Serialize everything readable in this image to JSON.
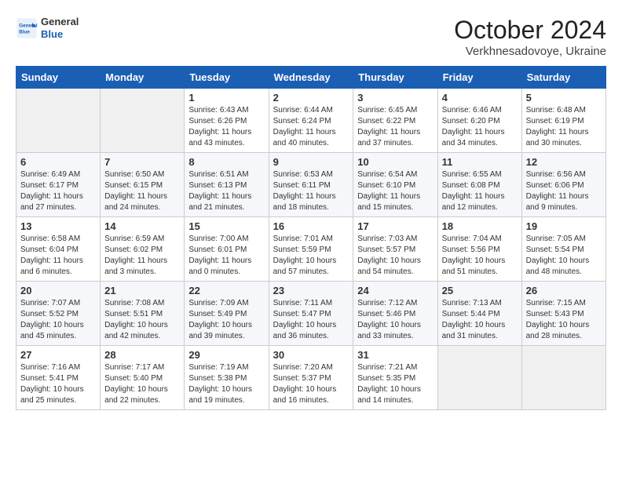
{
  "header": {
    "logo_general": "General",
    "logo_blue": "Blue",
    "month": "October 2024",
    "location": "Verkhnesadovoye, Ukraine"
  },
  "weekdays": [
    "Sunday",
    "Monday",
    "Tuesday",
    "Wednesday",
    "Thursday",
    "Friday",
    "Saturday"
  ],
  "weeks": [
    [
      {
        "day": "",
        "info": ""
      },
      {
        "day": "",
        "info": ""
      },
      {
        "day": "1",
        "info": "Sunrise: 6:43 AM\nSunset: 6:26 PM\nDaylight: 11 hours and 43 minutes."
      },
      {
        "day": "2",
        "info": "Sunrise: 6:44 AM\nSunset: 6:24 PM\nDaylight: 11 hours and 40 minutes."
      },
      {
        "day": "3",
        "info": "Sunrise: 6:45 AM\nSunset: 6:22 PM\nDaylight: 11 hours and 37 minutes."
      },
      {
        "day": "4",
        "info": "Sunrise: 6:46 AM\nSunset: 6:20 PM\nDaylight: 11 hours and 34 minutes."
      },
      {
        "day": "5",
        "info": "Sunrise: 6:48 AM\nSunset: 6:19 PM\nDaylight: 11 hours and 30 minutes."
      }
    ],
    [
      {
        "day": "6",
        "info": "Sunrise: 6:49 AM\nSunset: 6:17 PM\nDaylight: 11 hours and 27 minutes."
      },
      {
        "day": "7",
        "info": "Sunrise: 6:50 AM\nSunset: 6:15 PM\nDaylight: 11 hours and 24 minutes."
      },
      {
        "day": "8",
        "info": "Sunrise: 6:51 AM\nSunset: 6:13 PM\nDaylight: 11 hours and 21 minutes."
      },
      {
        "day": "9",
        "info": "Sunrise: 6:53 AM\nSunset: 6:11 PM\nDaylight: 11 hours and 18 minutes."
      },
      {
        "day": "10",
        "info": "Sunrise: 6:54 AM\nSunset: 6:10 PM\nDaylight: 11 hours and 15 minutes."
      },
      {
        "day": "11",
        "info": "Sunrise: 6:55 AM\nSunset: 6:08 PM\nDaylight: 11 hours and 12 minutes."
      },
      {
        "day": "12",
        "info": "Sunrise: 6:56 AM\nSunset: 6:06 PM\nDaylight: 11 hours and 9 minutes."
      }
    ],
    [
      {
        "day": "13",
        "info": "Sunrise: 6:58 AM\nSunset: 6:04 PM\nDaylight: 11 hours and 6 minutes."
      },
      {
        "day": "14",
        "info": "Sunrise: 6:59 AM\nSunset: 6:02 PM\nDaylight: 11 hours and 3 minutes."
      },
      {
        "day": "15",
        "info": "Sunrise: 7:00 AM\nSunset: 6:01 PM\nDaylight: 11 hours and 0 minutes."
      },
      {
        "day": "16",
        "info": "Sunrise: 7:01 AM\nSunset: 5:59 PM\nDaylight: 10 hours and 57 minutes."
      },
      {
        "day": "17",
        "info": "Sunrise: 7:03 AM\nSunset: 5:57 PM\nDaylight: 10 hours and 54 minutes."
      },
      {
        "day": "18",
        "info": "Sunrise: 7:04 AM\nSunset: 5:56 PM\nDaylight: 10 hours and 51 minutes."
      },
      {
        "day": "19",
        "info": "Sunrise: 7:05 AM\nSunset: 5:54 PM\nDaylight: 10 hours and 48 minutes."
      }
    ],
    [
      {
        "day": "20",
        "info": "Sunrise: 7:07 AM\nSunset: 5:52 PM\nDaylight: 10 hours and 45 minutes."
      },
      {
        "day": "21",
        "info": "Sunrise: 7:08 AM\nSunset: 5:51 PM\nDaylight: 10 hours and 42 minutes."
      },
      {
        "day": "22",
        "info": "Sunrise: 7:09 AM\nSunset: 5:49 PM\nDaylight: 10 hours and 39 minutes."
      },
      {
        "day": "23",
        "info": "Sunrise: 7:11 AM\nSunset: 5:47 PM\nDaylight: 10 hours and 36 minutes."
      },
      {
        "day": "24",
        "info": "Sunrise: 7:12 AM\nSunset: 5:46 PM\nDaylight: 10 hours and 33 minutes."
      },
      {
        "day": "25",
        "info": "Sunrise: 7:13 AM\nSunset: 5:44 PM\nDaylight: 10 hours and 31 minutes."
      },
      {
        "day": "26",
        "info": "Sunrise: 7:15 AM\nSunset: 5:43 PM\nDaylight: 10 hours and 28 minutes."
      }
    ],
    [
      {
        "day": "27",
        "info": "Sunrise: 7:16 AM\nSunset: 5:41 PM\nDaylight: 10 hours and 25 minutes."
      },
      {
        "day": "28",
        "info": "Sunrise: 7:17 AM\nSunset: 5:40 PM\nDaylight: 10 hours and 22 minutes."
      },
      {
        "day": "29",
        "info": "Sunrise: 7:19 AM\nSunset: 5:38 PM\nDaylight: 10 hours and 19 minutes."
      },
      {
        "day": "30",
        "info": "Sunrise: 7:20 AM\nSunset: 5:37 PM\nDaylight: 10 hours and 16 minutes."
      },
      {
        "day": "31",
        "info": "Sunrise: 7:21 AM\nSunset: 5:35 PM\nDaylight: 10 hours and 14 minutes."
      },
      {
        "day": "",
        "info": ""
      },
      {
        "day": "",
        "info": ""
      }
    ]
  ]
}
